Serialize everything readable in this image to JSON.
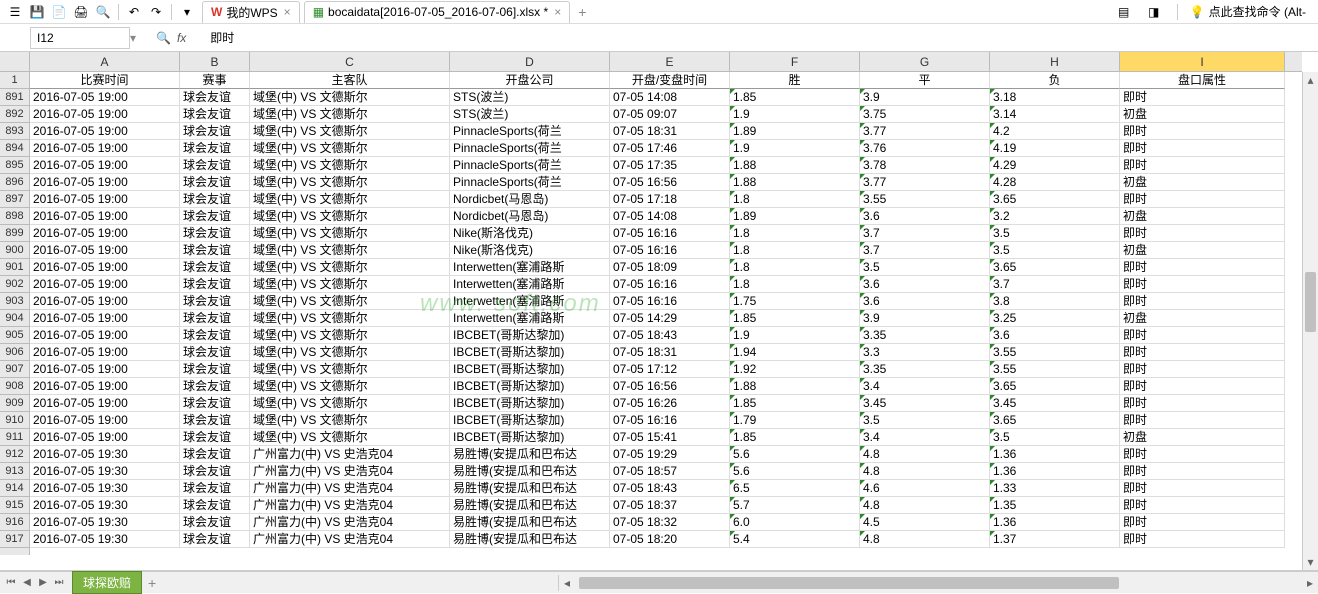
{
  "toolbar": {
    "wps_tab": "我的WPS",
    "file_tab": "bocaidata[2016-07-05_2016-07-06].xlsx *",
    "search_hint": "点此查找命令 (Alt-"
  },
  "formula_bar": {
    "name_box": "I12",
    "formula_value": "即时"
  },
  "columns": [
    "A",
    "B",
    "C",
    "D",
    "E",
    "F",
    "G",
    "H",
    "I"
  ],
  "header_row": {
    "num": "1",
    "A": "比赛时间",
    "B": "赛事",
    "C": "主客队",
    "D": "开盘公司",
    "E": "开盘/变盘时间",
    "F": "胜",
    "G": "平",
    "H": "负",
    "I": "盘口属性"
  },
  "rows": [
    {
      "num": "891",
      "A": "2016-07-05 19:00",
      "B": "球会友谊",
      "C": "域堡(中) VS 文德斯尔",
      "D": "STS(波兰)",
      "E": "07-05 14:08",
      "F": "1.85",
      "G": "3.9",
      "H": "3.18",
      "I": "即时"
    },
    {
      "num": "892",
      "A": "2016-07-05 19:00",
      "B": "球会友谊",
      "C": "域堡(中) VS 文德斯尔",
      "D": "STS(波兰)",
      "E": "07-05 09:07",
      "F": "1.9",
      "G": "3.75",
      "H": "3.14",
      "I": "初盘"
    },
    {
      "num": "893",
      "A": "2016-07-05 19:00",
      "B": "球会友谊",
      "C": "域堡(中) VS 文德斯尔",
      "D": "PinnacleSports(荷兰",
      "E": "07-05 18:31",
      "F": "1.89",
      "G": "3.77",
      "H": "4.2",
      "I": "即时"
    },
    {
      "num": "894",
      "A": "2016-07-05 19:00",
      "B": "球会友谊",
      "C": "域堡(中) VS 文德斯尔",
      "D": "PinnacleSports(荷兰",
      "E": "07-05 17:46",
      "F": "1.9",
      "G": "3.76",
      "H": "4.19",
      "I": "即时"
    },
    {
      "num": "895",
      "A": "2016-07-05 19:00",
      "B": "球会友谊",
      "C": "域堡(中) VS 文德斯尔",
      "D": "PinnacleSports(荷兰",
      "E": "07-05 17:35",
      "F": "1.88",
      "G": "3.78",
      "H": "4.29",
      "I": "即时"
    },
    {
      "num": "896",
      "A": "2016-07-05 19:00",
      "B": "球会友谊",
      "C": "域堡(中) VS 文德斯尔",
      "D": "PinnacleSports(荷兰",
      "E": "07-05 16:56",
      "F": "1.88",
      "G": "3.77",
      "H": "4.28",
      "I": "初盘"
    },
    {
      "num": "897",
      "A": "2016-07-05 19:00",
      "B": "球会友谊",
      "C": "域堡(中) VS 文德斯尔",
      "D": "Nordicbet(马恩岛)",
      "E": "07-05 17:18",
      "F": "1.8",
      "G": "3.55",
      "H": "3.65",
      "I": "即时"
    },
    {
      "num": "898",
      "A": "2016-07-05 19:00",
      "B": "球会友谊",
      "C": "域堡(中) VS 文德斯尔",
      "D": "Nordicbet(马恩岛)",
      "E": "07-05 14:08",
      "F": "1.89",
      "G": "3.6",
      "H": "3.2",
      "I": "初盘"
    },
    {
      "num": "899",
      "A": "2016-07-05 19:00",
      "B": "球会友谊",
      "C": "域堡(中) VS 文德斯尔",
      "D": "Nike(斯洛伐克)",
      "E": "07-05 16:16",
      "F": "1.8",
      "G": "3.7",
      "H": "3.5",
      "I": "即时"
    },
    {
      "num": "900",
      "A": "2016-07-05 19:00",
      "B": "球会友谊",
      "C": "域堡(中) VS 文德斯尔",
      "D": "Nike(斯洛伐克)",
      "E": "07-05 16:16",
      "F": "1.8",
      "G": "3.7",
      "H": "3.5",
      "I": "初盘"
    },
    {
      "num": "901",
      "A": "2016-07-05 19:00",
      "B": "球会友谊",
      "C": "域堡(中) VS 文德斯尔",
      "D": "Interwetten(塞浦路斯",
      "E": "07-05 18:09",
      "F": "1.8",
      "G": "3.5",
      "H": "3.65",
      "I": "即时"
    },
    {
      "num": "902",
      "A": "2016-07-05 19:00",
      "B": "球会友谊",
      "C": "域堡(中) VS 文德斯尔",
      "D": "Interwetten(塞浦路斯",
      "E": "07-05 16:16",
      "F": "1.8",
      "G": "3.6",
      "H": "3.7",
      "I": "即时"
    },
    {
      "num": "903",
      "A": "2016-07-05 19:00",
      "B": "球会友谊",
      "C": "域堡(中) VS 文德斯尔",
      "D": "Interwetten(塞浦路斯",
      "E": "07-05 16:16",
      "F": "1.75",
      "G": "3.6",
      "H": "3.8",
      "I": "即时"
    },
    {
      "num": "904",
      "A": "2016-07-05 19:00",
      "B": "球会友谊",
      "C": "域堡(中) VS 文德斯尔",
      "D": "Interwetten(塞浦路斯",
      "E": "07-05 14:29",
      "F": "1.85",
      "G": "3.9",
      "H": "3.25",
      "I": "初盘"
    },
    {
      "num": "905",
      "A": "2016-07-05 19:00",
      "B": "球会友谊",
      "C": "域堡(中) VS 文德斯尔",
      "D": "IBCBET(哥斯达黎加)",
      "E": "07-05 18:43",
      "F": "1.9",
      "G": "3.35",
      "H": "3.6",
      "I": "即时"
    },
    {
      "num": "906",
      "A": "2016-07-05 19:00",
      "B": "球会友谊",
      "C": "域堡(中) VS 文德斯尔",
      "D": "IBCBET(哥斯达黎加)",
      "E": "07-05 18:31",
      "F": "1.94",
      "G": "3.3",
      "H": "3.55",
      "I": "即时"
    },
    {
      "num": "907",
      "A": "2016-07-05 19:00",
      "B": "球会友谊",
      "C": "域堡(中) VS 文德斯尔",
      "D": "IBCBET(哥斯达黎加)",
      "E": "07-05 17:12",
      "F": "1.92",
      "G": "3.35",
      "H": "3.55",
      "I": "即时"
    },
    {
      "num": "908",
      "A": "2016-07-05 19:00",
      "B": "球会友谊",
      "C": "域堡(中) VS 文德斯尔",
      "D": "IBCBET(哥斯达黎加)",
      "E": "07-05 16:56",
      "F": "1.88",
      "G": "3.4",
      "H": "3.65",
      "I": "即时"
    },
    {
      "num": "909",
      "A": "2016-07-05 19:00",
      "B": "球会友谊",
      "C": "域堡(中) VS 文德斯尔",
      "D": "IBCBET(哥斯达黎加)",
      "E": "07-05 16:26",
      "F": "1.85",
      "G": "3.45",
      "H": "3.45",
      "I": "即时"
    },
    {
      "num": "910",
      "A": "2016-07-05 19:00",
      "B": "球会友谊",
      "C": "域堡(中) VS 文德斯尔",
      "D": "IBCBET(哥斯达黎加)",
      "E": "07-05 16:16",
      "F": "1.79",
      "G": "3.5",
      "H": "3.65",
      "I": "即时"
    },
    {
      "num": "911",
      "A": "2016-07-05 19:00",
      "B": "球会友谊",
      "C": "域堡(中) VS 文德斯尔",
      "D": "IBCBET(哥斯达黎加)",
      "E": "07-05 15:41",
      "F": "1.85",
      "G": "3.4",
      "H": "3.5",
      "I": "初盘"
    },
    {
      "num": "912",
      "A": "2016-07-05 19:30",
      "B": "球会友谊",
      "C": "广州富力(中) VS 史浩克04",
      "D": "易胜博(安提瓜和巴布达",
      "E": "07-05 19:29",
      "F": "5.6",
      "G": "4.8",
      "H": "1.36",
      "I": "即时"
    },
    {
      "num": "913",
      "A": "2016-07-05 19:30",
      "B": "球会友谊",
      "C": "广州富力(中) VS 史浩克04",
      "D": "易胜博(安提瓜和巴布达",
      "E": "07-05 18:57",
      "F": "5.6",
      "G": "4.8",
      "H": "1.36",
      "I": "即时"
    },
    {
      "num": "914",
      "A": "2016-07-05 19:30",
      "B": "球会友谊",
      "C": "广州富力(中) VS 史浩克04",
      "D": "易胜博(安提瓜和巴布达",
      "E": "07-05 18:43",
      "F": "6.5",
      "G": "4.6",
      "H": "1.33",
      "I": "即时"
    },
    {
      "num": "915",
      "A": "2016-07-05 19:30",
      "B": "球会友谊",
      "C": "广州富力(中) VS 史浩克04",
      "D": "易胜博(安提瓜和巴布达",
      "E": "07-05 18:37",
      "F": "5.7",
      "G": "4.8",
      "H": "1.35",
      "I": "即时"
    },
    {
      "num": "916",
      "A": "2016-07-05 19:30",
      "B": "球会友谊",
      "C": "广州富力(中) VS 史浩克04",
      "D": "易胜博(安提瓜和巴布达",
      "E": "07-05 18:32",
      "F": "6.0",
      "G": "4.5",
      "H": "1.36",
      "I": "即时"
    },
    {
      "num": "917",
      "A": "2016-07-05 19:30",
      "B": "球会友谊",
      "C": "广州富力(中) VS 史浩克04",
      "D": "易胜博(安提瓜和巴布达",
      "E": "07-05 18:20",
      "F": "5.4",
      "G": "4.8",
      "H": "1.37",
      "I": "即时"
    }
  ],
  "sheet_tabs": {
    "active": "球探欧赔"
  },
  "watermark": "www.      soft.com"
}
